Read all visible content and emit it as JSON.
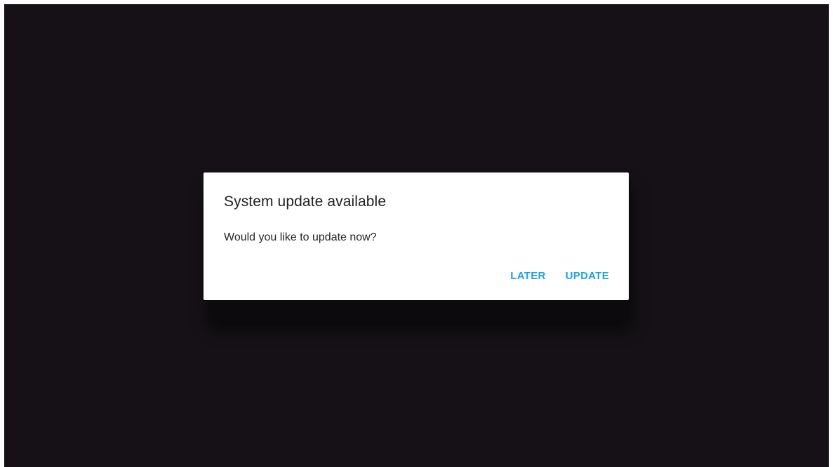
{
  "dialog": {
    "title": "System update available",
    "message": "Would you like to update now?",
    "actions": {
      "later_label": "LATER",
      "update_label": "UPDATE"
    }
  },
  "colors": {
    "background": "#151116",
    "dialog": "#ffffff",
    "accent": "#1aa3dd",
    "title_text": "#202020",
    "body_text": "#262626"
  }
}
